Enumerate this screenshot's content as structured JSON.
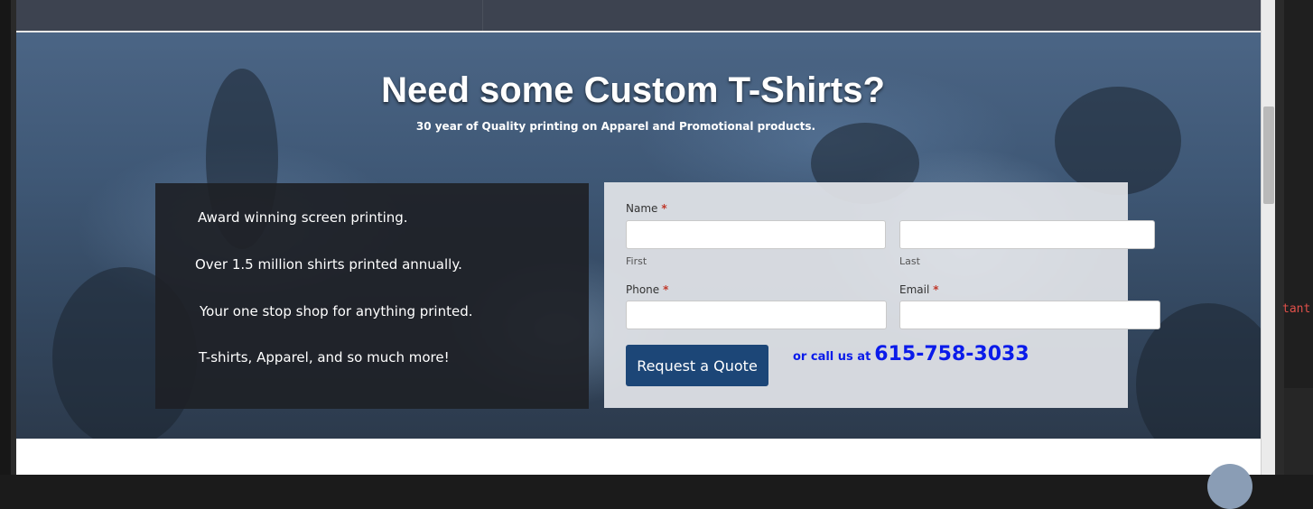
{
  "hero": {
    "title": "Need some Custom T-Shirts?",
    "subtitle": "30 year of Quality printing on Apparel and Promotional products."
  },
  "features": {
    "items": [
      "Award winning screen printing.",
      "Over 1.5 million shirts printed annually.",
      "Your one stop shop for anything printed.",
      "T-shirts, Apparel, and so much more!"
    ]
  },
  "form": {
    "name_label": "Name",
    "required_mark": "*",
    "first_sublabel": "First",
    "last_sublabel": "Last",
    "phone_label": "Phone",
    "email_label": "Email",
    "submit_label": "Request a Quote",
    "call_prefix": "or call us at",
    "phone_number": "615-758-3033",
    "first_value": "",
    "last_value": "",
    "phone_value": "",
    "email_value": ""
  },
  "side_panel": {
    "code_fragment": "tant"
  },
  "colors": {
    "button_bg": "#1c4677",
    "phone_link": "#0a1bea",
    "required": "#c0392b"
  }
}
